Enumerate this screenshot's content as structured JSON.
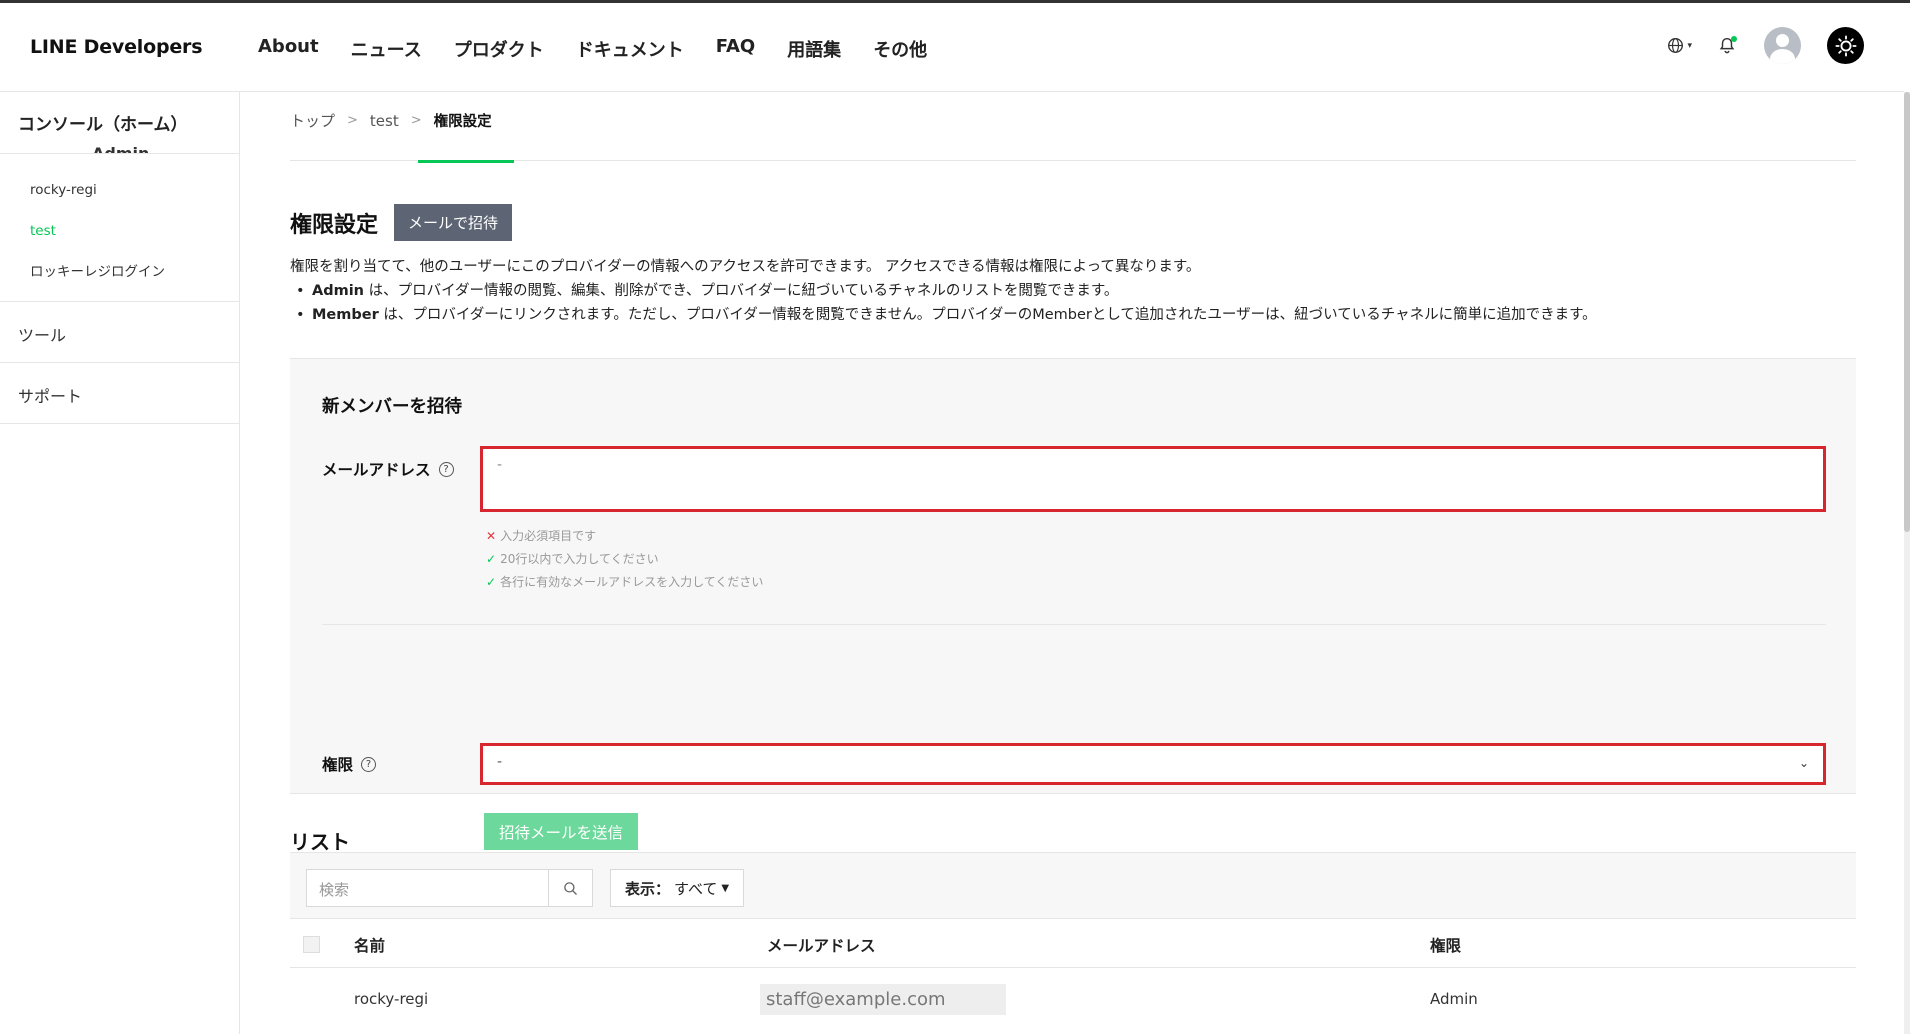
{
  "header": {
    "logo": "LINE Developers",
    "nav": [
      "About",
      "ニュース",
      "プロダクト",
      "ドキュメント",
      "FAQ",
      "用語集",
      "その他"
    ],
    "language_icon": "globe-icon",
    "notification_icon": "bell-icon",
    "theme_icon": "sun-icon"
  },
  "sidebar": {
    "home": "コンソール（ホーム）",
    "cut_text": "Admin",
    "items": [
      "rocky-regi",
      "test",
      "ロッキーレジログイン"
    ],
    "active_item": "test",
    "sections": [
      "ツール",
      "サポート"
    ]
  },
  "breadcrumb": {
    "items": [
      "トップ",
      "test"
    ],
    "current": "権限設定"
  },
  "page": {
    "title": "権限設定",
    "invite_button": "メールで招待",
    "description": "権限を割り当てて、他のユーザーにこのプロバイダーの情報へのアクセスを許可できます。 アクセスできる情報は権限によって異なります。",
    "bullets": [
      {
        "role": "Admin",
        "text": " は、プロバイダー情報の閲覧、編集、削除ができ、プロバイダーに紐づいているチャネルのリストを閲覧できます。"
      },
      {
        "role": "Member",
        "text": " は、プロバイダーにリンクされます。ただし、プロバイダー情報を閲覧できません。プロバイダーのMemberとして追加されたユーザーは、紐づいているチャネルに簡単に追加できます。"
      }
    ]
  },
  "invite_form": {
    "title": "新メンバーを招待",
    "email_label": "メールアドレス",
    "email_value": "-",
    "rules": [
      {
        "status": "error",
        "text": "入力必須項目です"
      },
      {
        "status": "ok",
        "text": "20行以内で入力してください"
      },
      {
        "status": "ok",
        "text": "各行に有効なメールアドレスを入力してください"
      }
    ],
    "permission_label": "権限",
    "permission_value": "-",
    "send_button": "招待メールを送信"
  },
  "list": {
    "title": "リスト",
    "search_placeholder": "検索",
    "filter_label": "表示：",
    "filter_value": "すべて",
    "columns": [
      "名前",
      "メールアドレス",
      "権限"
    ],
    "rows": [
      {
        "name": "rocky-regi",
        "email": "staff@example.com",
        "role": "Admin"
      }
    ]
  },
  "colors": {
    "accent": "#06c755",
    "error_outline": "#d7262f",
    "invite_button": "#5d6574",
    "send_button": "#6dd89b"
  }
}
